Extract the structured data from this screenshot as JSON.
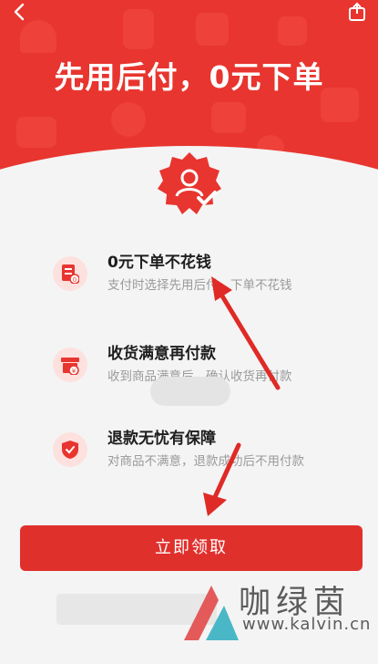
{
  "header": {
    "headline": "先用后付，0元下单",
    "back_icon": "back-arrow-icon",
    "share_icon": "share-icon",
    "badge_icon": "user-verified-badge-icon"
  },
  "features": [
    {
      "title": "0元下单不花钱",
      "desc": "支付时选择先用后付，下单不花钱",
      "icon": "order-zero-icon"
    },
    {
      "title": "收货满意再付款",
      "desc": "收到商品满意后，确认收货再付款",
      "icon": "payment-box-icon"
    },
    {
      "title": "退款无忧有保障",
      "desc": "对商品不满意，退款成功后不用付款",
      "icon": "shield-check-icon"
    }
  ],
  "cta": {
    "label": "立即领取"
  },
  "watermark": {
    "text": "咖绿茵",
    "url": "www.kalvin.cn"
  },
  "colors": {
    "primary": "#e8352f",
    "button": "#e0302c",
    "arrow": "#e02a26"
  }
}
